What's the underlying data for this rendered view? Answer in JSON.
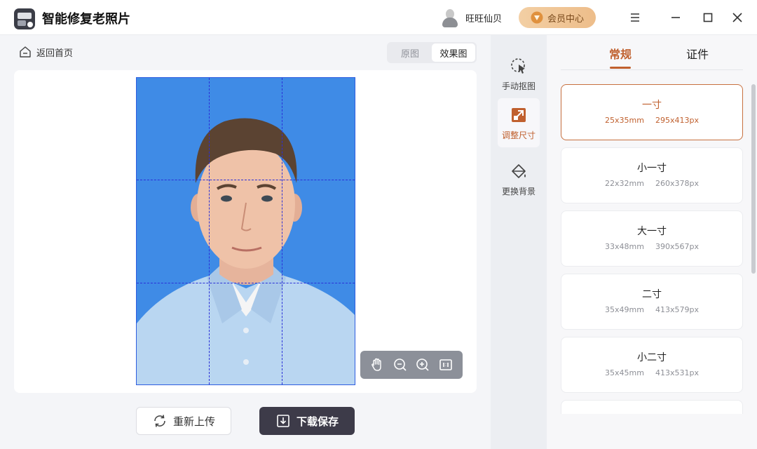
{
  "app": {
    "title": "智能修复老照片"
  },
  "user": {
    "name": "旺旺仙贝"
  },
  "vip": {
    "label": "会员中心"
  },
  "nav": {
    "back_label": "返回首页"
  },
  "view_toggle": {
    "original": "原图",
    "result": "效果图",
    "active": "效果图"
  },
  "tools": [
    {
      "label": "手动抠图",
      "icon": "manual-cutout-icon"
    },
    {
      "label": "调整尺寸",
      "icon": "resize-icon",
      "active": true
    },
    {
      "label": "更换背景",
      "icon": "paint-bucket-icon"
    }
  ],
  "tabs": {
    "regular": "常规",
    "id_photo": "证件",
    "active": "常规"
  },
  "sizes": [
    {
      "name": "一寸",
      "mm": "25x35mm",
      "px": "295x413px",
      "selected": true
    },
    {
      "name": "小一寸",
      "mm": "22x32mm",
      "px": "260x378px"
    },
    {
      "name": "大一寸",
      "mm": "33x48mm",
      "px": "390x567px"
    },
    {
      "name": "二寸",
      "mm": "35x49mm",
      "px": "413x579px"
    },
    {
      "name": "小二寸",
      "mm": "35x45mm",
      "px": "413x531px"
    }
  ],
  "actions": {
    "reupload": "重新上传",
    "download": "下载保存"
  },
  "zoom_tools": [
    "hand-icon",
    "zoom-out-icon",
    "zoom-in-icon",
    "fit-screen-icon"
  ],
  "colors": {
    "accent": "#c0602e",
    "photo_background": "#3f8be6",
    "download_button": "#3d3b49"
  }
}
